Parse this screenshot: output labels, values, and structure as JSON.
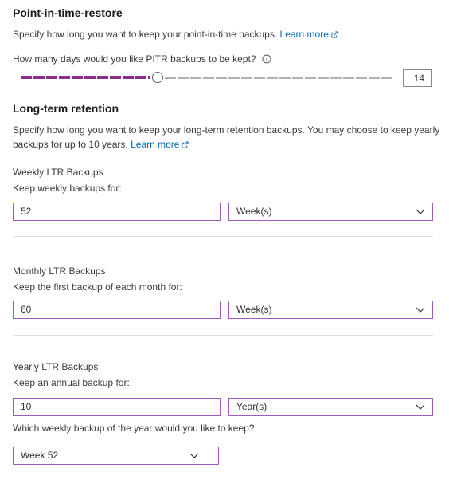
{
  "pitr": {
    "title": "Point-in-time-restore",
    "description": "Specify how long you want to keep your point-in-time backups.",
    "learn_more": "Learn more",
    "question": "How many days would you like PITR backups to be kept?",
    "info_icon": "info-icon",
    "days_value": "14",
    "slider_fill_fraction": 0.37
  },
  "ltr": {
    "title": "Long-term retention",
    "description": "Specify how long you want to keep your long-term retention backups. You may choose to keep yearly backups for up to 10 years.",
    "learn_more": "Learn more",
    "weekly": {
      "heading": "Weekly LTR Backups",
      "label": "Keep weekly backups for:",
      "value": "52",
      "unit": "Week(s)"
    },
    "monthly": {
      "heading": "Monthly LTR Backups",
      "label": "Keep the first backup of each month for:",
      "value": "60",
      "unit": "Week(s)"
    },
    "yearly": {
      "heading": "Yearly LTR Backups",
      "label": "Keep an annual backup for:",
      "value": "10",
      "unit": "Year(s)",
      "week_question": "Which weekly backup of the year would you like to keep?",
      "week_value": "Week 52"
    }
  },
  "icons": {
    "external_link": "external-link-icon",
    "chevron": "chevron-down-icon"
  },
  "colors": {
    "accent": "#8a2d8e",
    "input_border": "#a05bb8",
    "link": "#0067b8"
  }
}
